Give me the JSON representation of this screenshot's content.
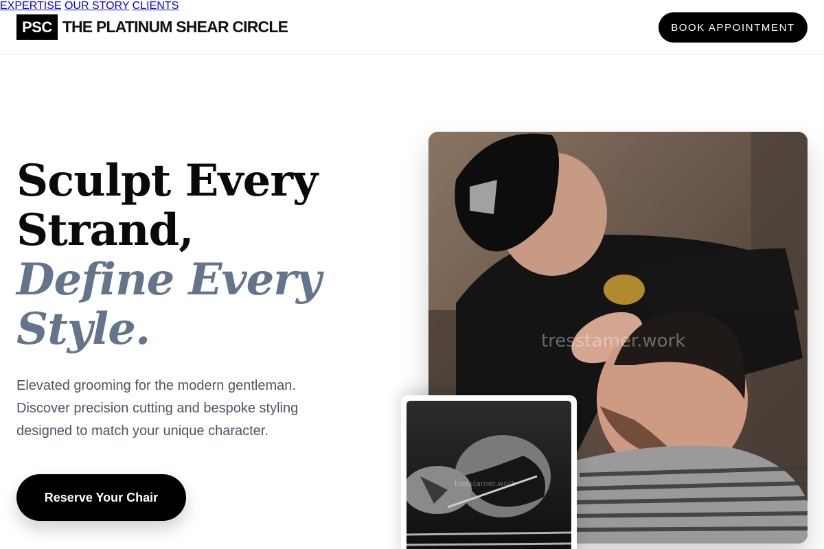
{
  "brand": {
    "mark": "PSC",
    "name": "THE PLATINUM SHEAR CIRCLE"
  },
  "nav": {
    "items": [
      {
        "label": "EXPERTISE"
      },
      {
        "label": "OUR STORY"
      },
      {
        "label": "CLIENTS"
      }
    ],
    "book_label": "BOOK APPOINTMENT"
  },
  "hero": {
    "headline_line1": "Sculpt Every",
    "headline_line2": "Strand,",
    "headline_line3": "Define Every",
    "headline_line4": "Style.",
    "subtext": "Elevated grooming for the modern gentleman. Discover precision cutting and bespoke styling designed to match your unique character.",
    "cta_label": "Reserve Your Chair"
  },
  "images": {
    "main_watermark": "tresstamer.work",
    "inset_watermark": "tresstamer.work"
  },
  "colors": {
    "accent_text": "#64748b",
    "primary": "#000000",
    "body_text": "#4b5563"
  }
}
